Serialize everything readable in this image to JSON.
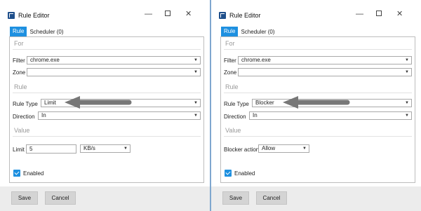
{
  "windows": [
    {
      "title": "Rule Editor",
      "tabs": {
        "active": "Rule",
        "other": "Scheduler (0)"
      },
      "sections": {
        "for": "For",
        "rule": "Rule",
        "value": "Value"
      },
      "filter": {
        "label": "Filter",
        "value": "chrome.exe"
      },
      "zone": {
        "label": "Zone",
        "value": ""
      },
      "rule_type": {
        "label": "Rule Type",
        "value": "Limit"
      },
      "direction": {
        "label": "Direction",
        "value": "In"
      },
      "limit": {
        "label": "Limit",
        "value": "5",
        "unit": "KB/s"
      },
      "enabled": {
        "label": "Enabled",
        "checked": true
      },
      "buttons": {
        "save": "Save",
        "cancel": "Cancel"
      }
    },
    {
      "title": "Rule Editor",
      "tabs": {
        "active": "Rule",
        "other": "Scheduler (0)"
      },
      "sections": {
        "for": "For",
        "rule": "Rule",
        "value": "Value"
      },
      "filter": {
        "label": "Filter",
        "value": "chrome.exe"
      },
      "zone": {
        "label": "Zone",
        "value": ""
      },
      "rule_type": {
        "label": "Rule Type",
        "value": "Blocker"
      },
      "direction": {
        "label": "Direction",
        "value": "In"
      },
      "blocker_action": {
        "label": "Blocker action",
        "value": "Allow"
      },
      "enabled": {
        "label": "Enabled",
        "checked": true
      },
      "buttons": {
        "save": "Save",
        "cancel": "Cancel"
      }
    }
  ],
  "icons": {
    "app": "rule-editor-app-icon",
    "minimize": "minimize-icon",
    "maximize": "maximize-icon",
    "close": "close-icon",
    "dropdown": "chevron-down-icon",
    "checkbox": "checkmark-icon",
    "annotation": "annotation-arrow-icon"
  },
  "colors": {
    "accent": "#1e90e0",
    "divider": "#7fa7cf",
    "footer": "#ececec",
    "annotation_arrow": "#777777"
  }
}
